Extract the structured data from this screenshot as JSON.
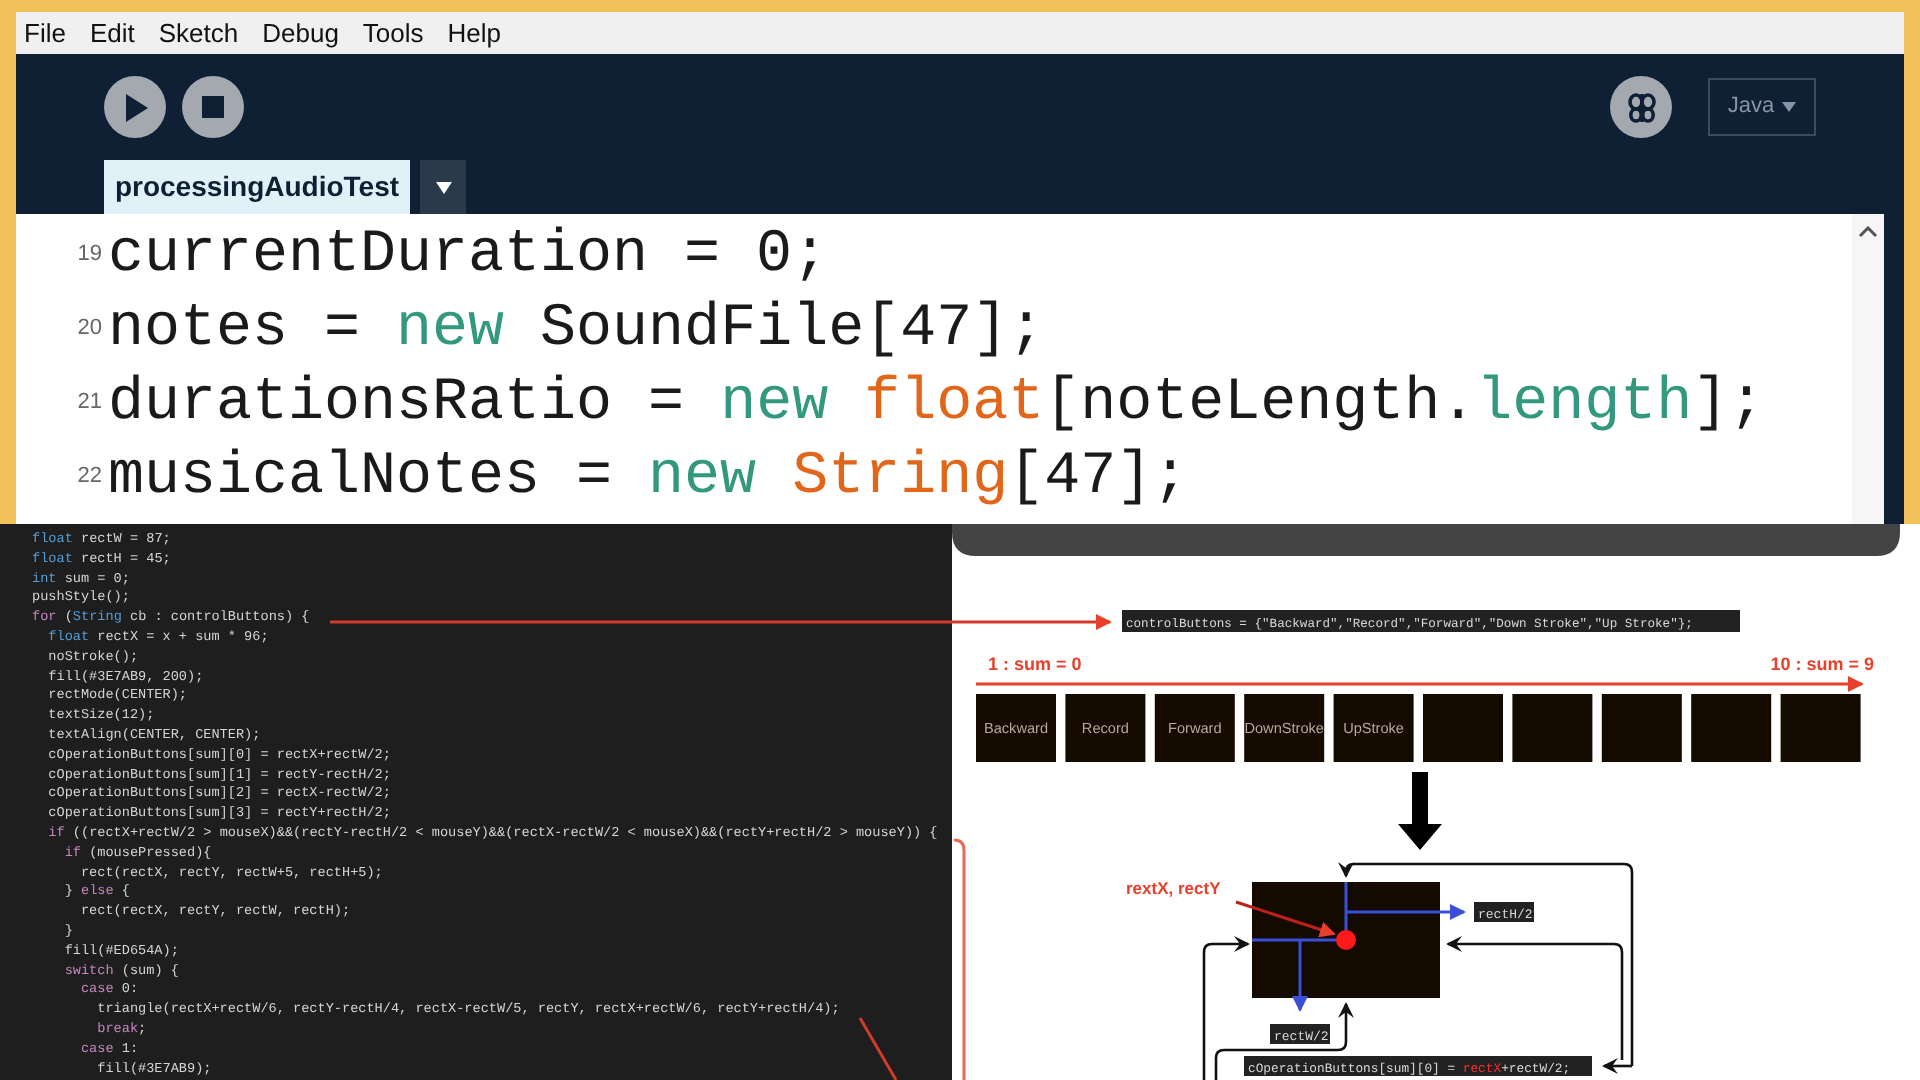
{
  "menu": [
    "File",
    "Edit",
    "Sketch",
    "Debug",
    "Tools",
    "Help"
  ],
  "mode": "Java",
  "tabs": [
    {
      "label": "processingAudioTest",
      "selected": true
    }
  ],
  "editor_lines": [
    {
      "number": "19",
      "parts": [
        {
          "kind": "plain",
          "text": "currentDuration = 0;"
        }
      ]
    },
    {
      "number": "20",
      "parts": [
        {
          "kind": "plain",
          "text": "notes = "
        },
        {
          "kind": "keyword",
          "text": "new"
        },
        {
          "kind": "plain",
          "text": " SoundFile[47];"
        }
      ]
    },
    {
      "number": "21",
      "parts": [
        {
          "kind": "plain",
          "text": "durationsRatio = "
        },
        {
          "kind": "keyword",
          "text": "new"
        },
        {
          "kind": "type",
          "text": " float"
        },
        {
          "kind": "plain",
          "text": "[noteLength."
        },
        {
          "kind": "keyword",
          "text": "length"
        },
        {
          "kind": "plain",
          "text": "];"
        }
      ]
    },
    {
      "number": "22",
      "parts": [
        {
          "kind": "plain",
          "text": "musicalNotes = "
        },
        {
          "kind": "keyword",
          "text": "new"
        },
        {
          "kind": "type",
          "text": " String"
        },
        {
          "kind": "plain",
          "text": "[47];"
        }
      ]
    }
  ],
  "code_lines": [
    [
      {
        "kind": "type",
        "text": "float"
      },
      {
        "kind": "plain",
        "text": " rectW = 87;"
      }
    ],
    [
      {
        "kind": "type",
        "text": "float"
      },
      {
        "kind": "plain",
        "text": " rectH = 45;"
      }
    ],
    [
      {
        "kind": "type",
        "text": "int"
      },
      {
        "kind": "plain",
        "text": " sum = 0;"
      }
    ],
    [
      {
        "kind": "plain",
        "text": "pushStyle();"
      }
    ],
    [
      {
        "kind": "control",
        "text": "for"
      },
      {
        "kind": "plain",
        "text": " ("
      },
      {
        "kind": "type",
        "text": "String"
      },
      {
        "kind": "plain",
        "text": " cb : controlButtons) {"
      }
    ],
    [
      {
        "kind": "type",
        "text": "  float"
      },
      {
        "kind": "plain",
        "text": " rectX = x + sum * 96;"
      }
    ],
    [
      {
        "kind": "plain",
        "text": "  noStroke();"
      }
    ],
    [
      {
        "kind": "plain",
        "text": "  fill(#3E7AB9, 200);"
      }
    ],
    [
      {
        "kind": "plain",
        "text": "  rectMode(CENTER);"
      }
    ],
    [
      {
        "kind": "plain",
        "text": "  textSize(12);"
      }
    ],
    [
      {
        "kind": "plain",
        "text": "  textAlign(CENTER, CENTER);"
      }
    ],
    [
      {
        "kind": "plain",
        "text": "  cOperationButtons[sum][0] = rectX+rectW/2;"
      }
    ],
    [
      {
        "kind": "plain",
        "text": "  cOperationButtons[sum][1] = rectY-rectH/2;"
      }
    ],
    [
      {
        "kind": "plain",
        "text": "  cOperationButtons[sum][2] = rectX-rectW/2;"
      }
    ],
    [
      {
        "kind": "plain",
        "text": "  cOperationButtons[sum][3] = rectY+rectH/2;"
      }
    ],
    [
      {
        "kind": "control",
        "text": "  if"
      },
      {
        "kind": "plain",
        "text": " ((rectX+rectW/2 > mouseX)&&(rectY-rectH/2 < mouseY)&&(rectX-rectW/2 < mouseX)&&(rectY+rectH/2 > mouseY)) {"
      }
    ],
    [
      {
        "kind": "control",
        "text": "    if"
      },
      {
        "kind": "plain",
        "text": " (mousePressed){"
      }
    ],
    [
      {
        "kind": "plain",
        "text": "      rect(rectX, rectY, rectW+5, rectH+5);"
      }
    ],
    [
      {
        "kind": "plain",
        "text": "    } "
      },
      {
        "kind": "control",
        "text": "else"
      },
      {
        "kind": "plain",
        "text": " {"
      }
    ],
    [
      {
        "kind": "plain",
        "text": "      rect(rectX, rectY, rectW, rectH);"
      }
    ],
    [
      {
        "kind": "plain",
        "text": "    }"
      }
    ],
    [
      {
        "kind": "plain",
        "text": "    fill(#ED654A);"
      }
    ],
    [
      {
        "kind": "control",
        "text": "    switch"
      },
      {
        "kind": "plain",
        "text": " (sum) {"
      }
    ],
    [
      {
        "kind": "control",
        "text": "      case"
      },
      {
        "kind": "plain",
        "text": " 0:"
      }
    ],
    [
      {
        "kind": "plain",
        "text": "        triangle(rectX+rectW/6, rectY-rectH/4, rectX-rectW/5, rectY, rectX+rectW/6, rectY+rectH/4);"
      }
    ],
    [
      {
        "kind": "control",
        "text": "        break"
      },
      {
        "kind": "plain",
        "text": ";"
      }
    ],
    [
      {
        "kind": "control",
        "text": "      case"
      },
      {
        "kind": "plain",
        "text": " 1:"
      }
    ],
    [
      {
        "kind": "plain",
        "text": "        fill(#3E7AB9);"
      }
    ]
  ],
  "diagram": {
    "array_label": "controlButtons = {\"Backward\",\"Record\",\"Forward\",\"Down Stroke\",\"Up Stroke\"};",
    "start_label": "1 : sum = 0",
    "end_label": "10 : sum = 9",
    "buttons": [
      "Backward",
      "Record",
      "Forward",
      "DownStroke",
      "UpStroke"
    ],
    "point_label": "rextX, rectY",
    "height_label": "rectH/2",
    "width_label": "rectW/2",
    "formula": [
      {
        "kind": "plain",
        "text": "cOperationButtons[sum][0] = "
      },
      {
        "kind": "highlight",
        "text": "rectX"
      },
      {
        "kind": "plain",
        "text": "+rectW/2;"
      }
    ]
  }
}
